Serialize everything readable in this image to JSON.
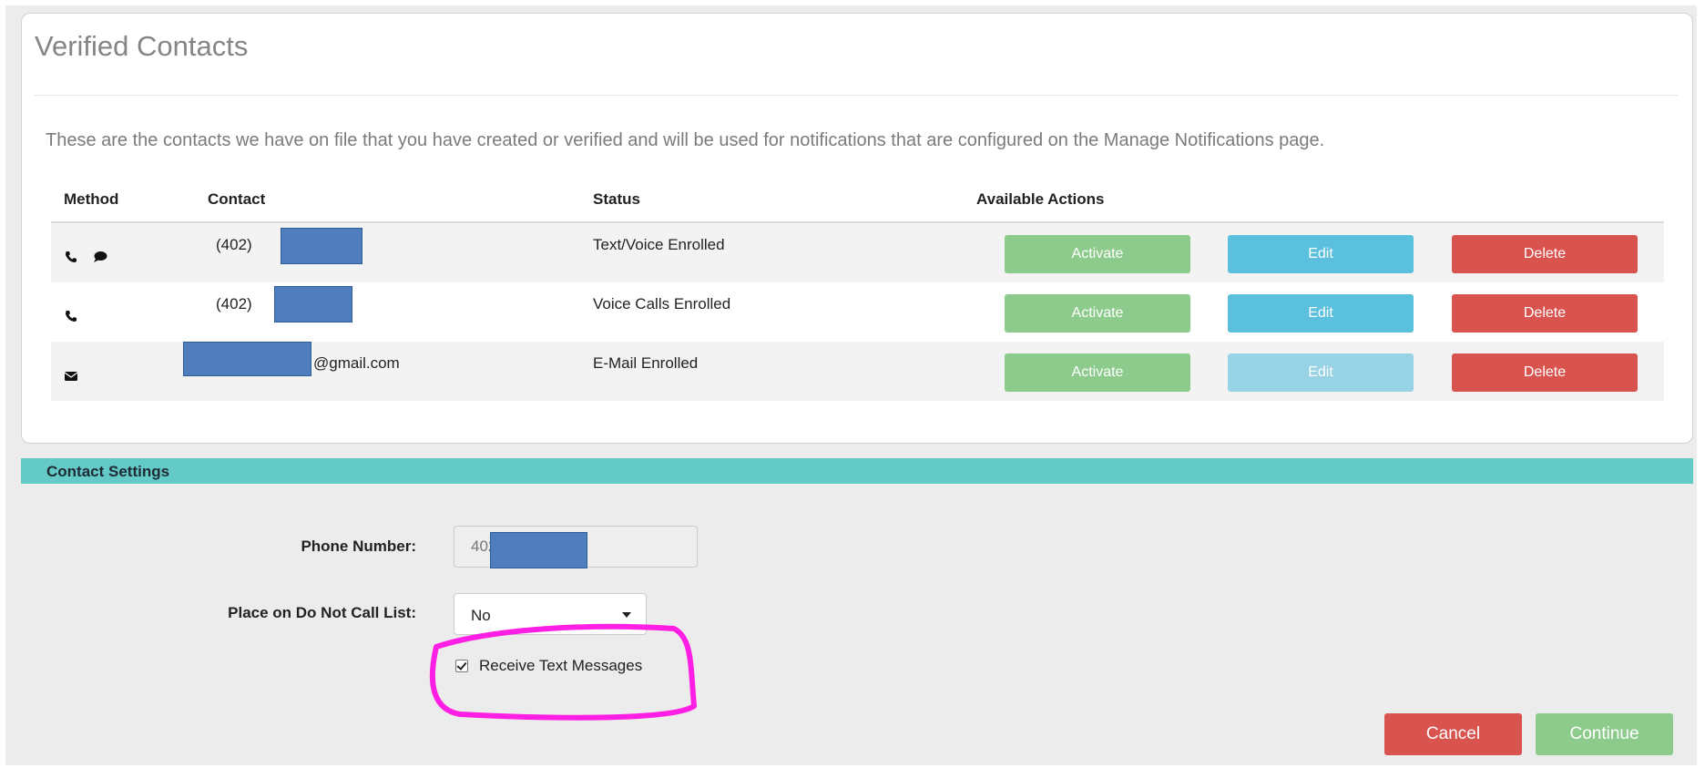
{
  "verified_contacts": {
    "title": "Verified Contacts",
    "intro": "These are the contacts we have on file that you have created or verified and will be used for notifications that are configured on the Manage Notifications page.",
    "columns": [
      "Method",
      "Contact",
      "Status",
      "Available Actions"
    ],
    "rows": [
      {
        "icons": [
          "phone-icon",
          "comment-icon"
        ],
        "contact": "(402)",
        "status": "Text/Voice Enrolled",
        "actions": [
          "Activate",
          "Edit",
          "Delete"
        ]
      },
      {
        "icons": [
          "phone-icon"
        ],
        "contact": "(402)",
        "status": "Voice Calls Enrolled",
        "actions": [
          "Activate",
          "Edit",
          "Delete"
        ]
      },
      {
        "icons": [
          "envelope-icon"
        ],
        "contact": "@gmail.com",
        "status": "E-Mail Enrolled",
        "actions": [
          "Activate",
          "Edit",
          "Delete"
        ]
      }
    ]
  },
  "contact_settings": {
    "header": "Contact Settings",
    "phone_label": "Phone Number:",
    "phone_value": "402-",
    "dnc_label": "Place on Do Not Call List:",
    "dnc_value": "No",
    "receive_text_label": "Receive Text Messages",
    "receive_text_checked": true,
    "cancel_label": "Cancel",
    "continue_label": "Continue"
  },
  "colors": {
    "success": "#8dcb8d",
    "info": "#5bc0de",
    "danger": "#d9534f",
    "settings_bar": "#63cac8",
    "annotation": "#ff1fe4"
  }
}
